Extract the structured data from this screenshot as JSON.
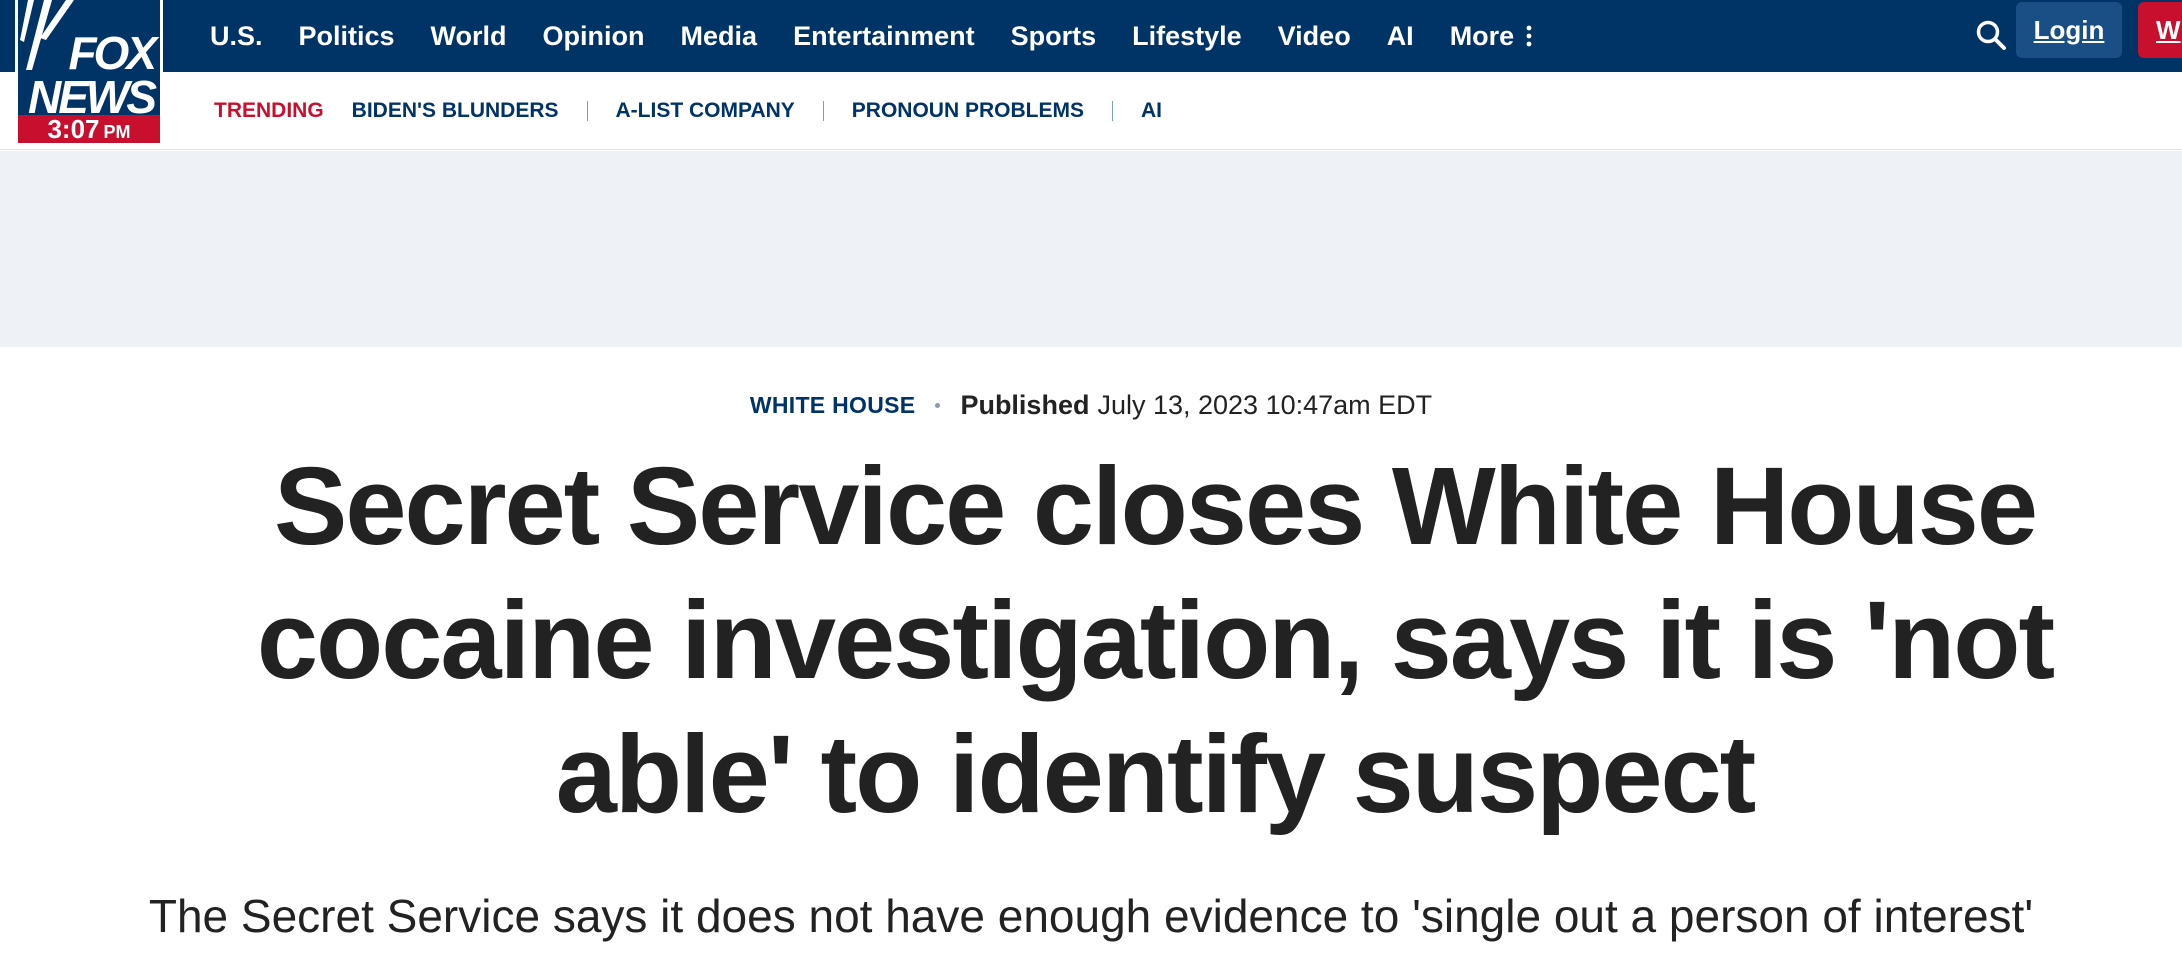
{
  "brand": {
    "logo_line1": "FOX",
    "logo_line2": "NEWS",
    "time": "3:07",
    "ampm": "PM",
    "primary_color": "#003366",
    "accent_color": "#c8102e"
  },
  "nav": {
    "items": [
      "U.S.",
      "Politics",
      "World",
      "Opinion",
      "Media",
      "Entertainment",
      "Sports",
      "Lifestyle",
      "Video",
      "AI"
    ],
    "more_label": "More",
    "search_icon": "search-icon",
    "login_label": "Login",
    "watch_label_visible": "W"
  },
  "trending": {
    "label": "TRENDING",
    "items": [
      "BIDEN'S BLUNDERS",
      "A-LIST COMPANY",
      "PRONOUN PROBLEMS",
      "AI"
    ]
  },
  "article": {
    "category": "WHITE HOUSE",
    "published_label": "Published",
    "published_date": "July 13, 2023 10:47am EDT",
    "headline_lines": [
      "Secret Service closes White House",
      "cocaine investigation, says it is 'not",
      "able' to identify suspect"
    ],
    "subhead": "The Secret Service says it does not have enough evidence to 'single out a person of interest'"
  }
}
